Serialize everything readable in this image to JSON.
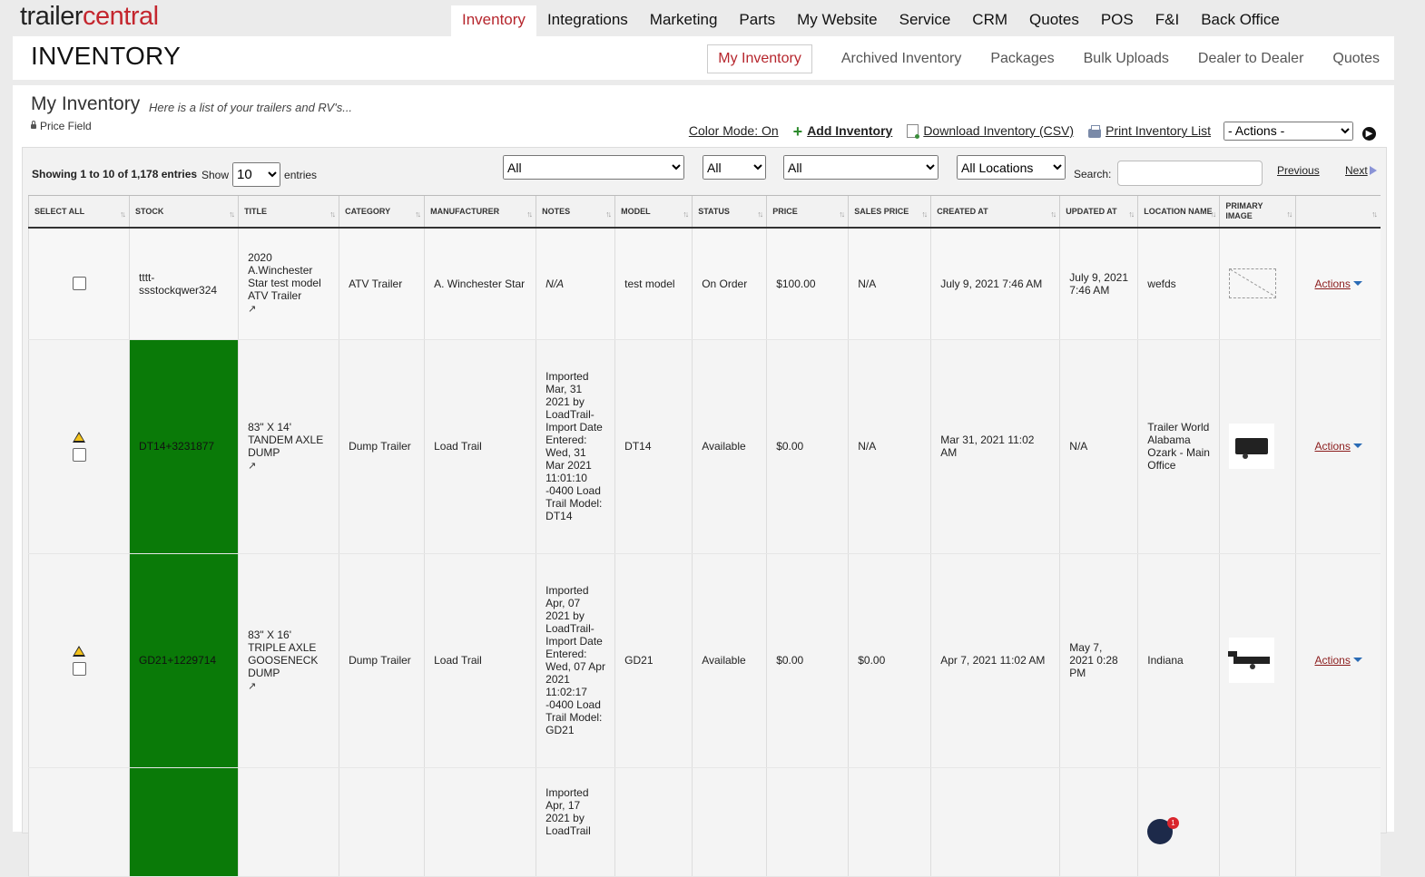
{
  "brand": {
    "part1": "trailer",
    "part2": "central"
  },
  "main_nav": [
    {
      "label": "Inventory",
      "active": true
    },
    {
      "label": "Integrations"
    },
    {
      "label": "Marketing"
    },
    {
      "label": "Parts"
    },
    {
      "label": "My Website"
    },
    {
      "label": "Service"
    },
    {
      "label": "CRM"
    },
    {
      "label": "Quotes"
    },
    {
      "label": "POS"
    },
    {
      "label": "F&I"
    },
    {
      "label": "Back Office"
    }
  ],
  "header": {
    "title": "INVENTORY"
  },
  "sub_nav": [
    {
      "label": "My Inventory",
      "active": true
    },
    {
      "label": "Archived Inventory"
    },
    {
      "label": "Packages"
    },
    {
      "label": "Bulk Uploads"
    },
    {
      "label": "Dealer to Dealer"
    },
    {
      "label": "Quotes"
    }
  ],
  "panel": {
    "title": "My Inventory",
    "subtitle": "Here is a list of your trailers and RV's...",
    "price_field": "Price Field"
  },
  "toolbar": {
    "color_mode": "Color Mode: On",
    "add_inventory": "Add Inventory",
    "download": "Download Inventory (CSV)",
    "print": "Print Inventory List",
    "actions_select": "- Actions -"
  },
  "table_controls": {
    "showing": "Showing 1 to 10 of 1,178 entries",
    "show_label": "Show",
    "show_value": "10",
    "entries_label": "entries",
    "filters": [
      "All",
      "All",
      "All",
      "All Locations"
    ],
    "search_label": "Search:",
    "previous": "Previous",
    "next": "Next"
  },
  "columns": [
    "Select All",
    "Stock",
    "Title",
    "Category",
    "Manufacturer",
    "Notes",
    "Model",
    "Status",
    "Price",
    "Sales Price",
    "Created At",
    "Updated At",
    "Location Name",
    "Primary Image",
    ""
  ],
  "rows": [
    {
      "warning": false,
      "stock": "tttt-ssstockqwer324",
      "stock_highlight": false,
      "title": "2020 A.Winchester Star test model ATV Trailer",
      "category": "ATV Trailer",
      "manufacturer": "A. Winchester Star",
      "notes": "N/A",
      "notes_italic": true,
      "model": "test model",
      "status": "On Order",
      "price": "$100.00",
      "sales_price": "N/A",
      "created_at": "July 9, 2021 7:46 AM",
      "updated_at": "July 9, 2021 7:46 AM",
      "location": "wefds",
      "image": "placeholder",
      "actions": "Actions"
    },
    {
      "warning": true,
      "stock": "DT14+3231877",
      "stock_highlight": true,
      "title": "83\" X 14' TANDEM AXLE DUMP",
      "category": "Dump Trailer",
      "manufacturer": "Load Trail",
      "notes": "Imported Mar, 31 2021 by LoadTrail-Import Date Entered: Wed, 31 Mar 2021 11:01:10 -0400 Load Trail Model: DT14",
      "notes_italic": false,
      "model": "DT14",
      "status": "Available",
      "price": "$0.00",
      "sales_price": "N/A",
      "created_at": "Mar 31, 2021 11:02 AM",
      "updated_at": "N/A",
      "location": "Trailer World Alabama Ozark - Main Office",
      "image": "dump-trailer",
      "actions": "Actions"
    },
    {
      "warning": true,
      "stock": "GD21+1229714",
      "stock_highlight": true,
      "title": "83\" X 16' TRIPLE AXLE GOOSENECK DUMP",
      "category": "Dump Trailer",
      "manufacturer": "Load Trail",
      "notes": "Imported Apr, 07 2021 by LoadTrail-Import Date Entered: Wed, 07 Apr 2021 11:02:17 -0400 Load Trail Model: GD21",
      "notes_italic": false,
      "model": "GD21",
      "status": "Available",
      "price": "$0.00",
      "sales_price": "$0.00",
      "created_at": "Apr 7, 2021 11:02 AM",
      "updated_at": "May 7, 2021 0:28 PM",
      "location": "Indiana",
      "image": "gooseneck-trailer",
      "actions": "Actions"
    },
    {
      "warning": false,
      "stock": "",
      "stock_highlight": true,
      "title": "",
      "category": "",
      "manufacturer": "",
      "notes": "Imported Apr, 17 2021 by LoadTrail",
      "notes_italic": false,
      "model": "",
      "status": "",
      "price": "",
      "sales_price": "",
      "created_at": "",
      "updated_at": "",
      "location": "",
      "image": "none",
      "actions": ""
    }
  ],
  "chat_badge": {
    "count": "1",
    "icon": "chat-icon"
  },
  "colors": {
    "brand_red": "#c4262e",
    "stock_highlight": "#0a7a08",
    "warning": "#f3c21b"
  }
}
